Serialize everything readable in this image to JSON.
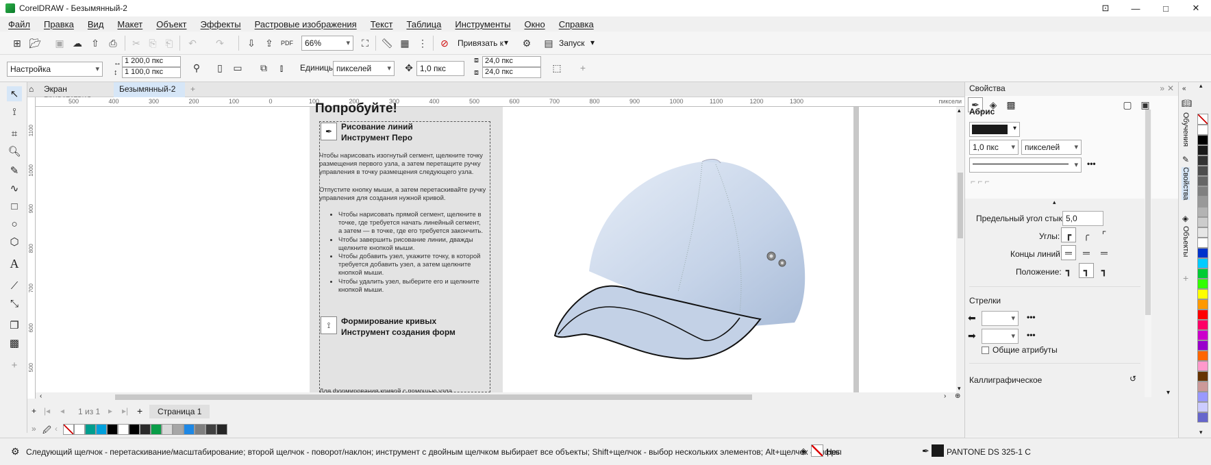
{
  "app": {
    "title": "CorelDRAW - Безымянный-2"
  },
  "menu": [
    "Файл",
    "Правка",
    "Вид",
    "Макет",
    "Объект",
    "Эффекты",
    "Растровые изображения",
    "Текст",
    "Таблица",
    "Инструменты",
    "Окно",
    "Справка"
  ],
  "toolbar": {
    "zoom": "66%",
    "snap_label": "Привязать к",
    "launch_label": "Запуск"
  },
  "property_bar": {
    "preset": "Настройка",
    "width": "1 200,0 пкс",
    "height": "1 100,0 пкс",
    "units_label": "Единицы:",
    "units_value": "пикселей",
    "nudge": "1,0 пкс",
    "dup_x": "24,0 пкс",
    "dup_y": "24,0 пкс"
  },
  "tabs": [
    "Экран приветствия",
    "Безымянный-2"
  ],
  "ruler_h_ticks": [
    "500",
    "400",
    "300",
    "200",
    "100",
    "0",
    "100",
    "200",
    "300",
    "400",
    "500",
    "600",
    "700",
    "800",
    "900",
    "1000",
    "1100",
    "1200",
    "1300"
  ],
  "ruler_h_unit": "пиксели",
  "ruler_v_ticks": [
    "1100",
    "1000",
    "900",
    "800",
    "700",
    "600",
    "500"
  ],
  "ruler_v_unit": "пиксели",
  "doc": {
    "heading": "Попробуйте!",
    "section1_title1": "Рисование линий",
    "section1_title2": "Инструмент Перо",
    "para1": "Чтобы нарисовать изогнутый сегмент, щелкните точку размещения первого узла, а затем перетащите ручку управления в точку размещения следующего узла.",
    "para2": "Отпустите кнопку мыши, а затем перетаскивайте ручку управления для создания нужной кривой.",
    "bullets": [
      "Чтобы нарисовать прямой сегмент, щелкните в точке, где требуется начать линейный сегмент, а затем — в точке, где его требуется закончить.",
      "Чтобы завершить рисование линии, дважды щелкните кнопкой мыши.",
      "Чтобы добавить узел, укажите точку, в которой требуется добавить узел, а затем щелкните кнопкой мыши.",
      "Чтобы удалить узел, выберите его и щелкните кнопкой мыши."
    ],
    "section2_title1": "Формирование кривых",
    "section2_title2": "Инструмент создания форм",
    "para3": "Для формирования кривой с помощью узла"
  },
  "pagenav": {
    "count": "1 из 1",
    "page_tab": "Страница 1"
  },
  "properties": {
    "title": "Свойства",
    "outline_label": "Абрис",
    "width_value": "1,0 пкс",
    "units_value": "пикселей",
    "miter_label": "Предельный угол стыка:",
    "miter_value": "5,0",
    "corners_label": "Углы:",
    "caps_label": "Концы линий:",
    "position_label": "Положение:",
    "arrows_label": "Стрелки",
    "shared_attrs_label": "Общие атрибуты",
    "calligraphic_label": "Каллиграфическое"
  },
  "side_tabs": [
    "Обучения",
    "Свойства",
    "Объекты"
  ],
  "status": {
    "hint": "Следующий щелчок - перетаскивание/масштабирование; второй щелчок - поворот/наклон; инструмент с двойным щелчком выбирает все объекты; Shift+щелчок - выбор нескольких элементов; Alt+щелчок - цифры",
    "fill_value": "Нет",
    "outline_color": "PANTONE DS 325-1 C"
  },
  "colors": {
    "accent": "#d6e6f7",
    "cap": "#c9d6ea",
    "palette_bottom": [
      "#ffffff",
      "#009e8e",
      "#00a0dc",
      "#000000",
      "#ffffff",
      "#000000",
      "#2a2a2a",
      "#0a9d48",
      "#d9d9d9",
      "#a6a6a6",
      "#1e88e5",
      "#7f7f7f",
      "#404040",
      "#262626"
    ],
    "palette_right": [
      "#ffffff",
      "#000000",
      "#1a1a1a",
      "#333333",
      "#4d4d4d",
      "#666666",
      "#808080",
      "#999999",
      "#b3b3b3",
      "#cccccc",
      "#e6e6e6",
      "#ffffff",
      "#0033cc",
      "#00ccff",
      "#00cc33",
      "#33ff00",
      "#ffff00",
      "#ff9900",
      "#ff0000",
      "#ff0066",
      "#cc00cc",
      "#9900cc",
      "#ff6600",
      "#ff99cc",
      "#663300",
      "#cc9999",
      "#9999ff",
      "#ccccff",
      "#6666cc"
    ]
  }
}
